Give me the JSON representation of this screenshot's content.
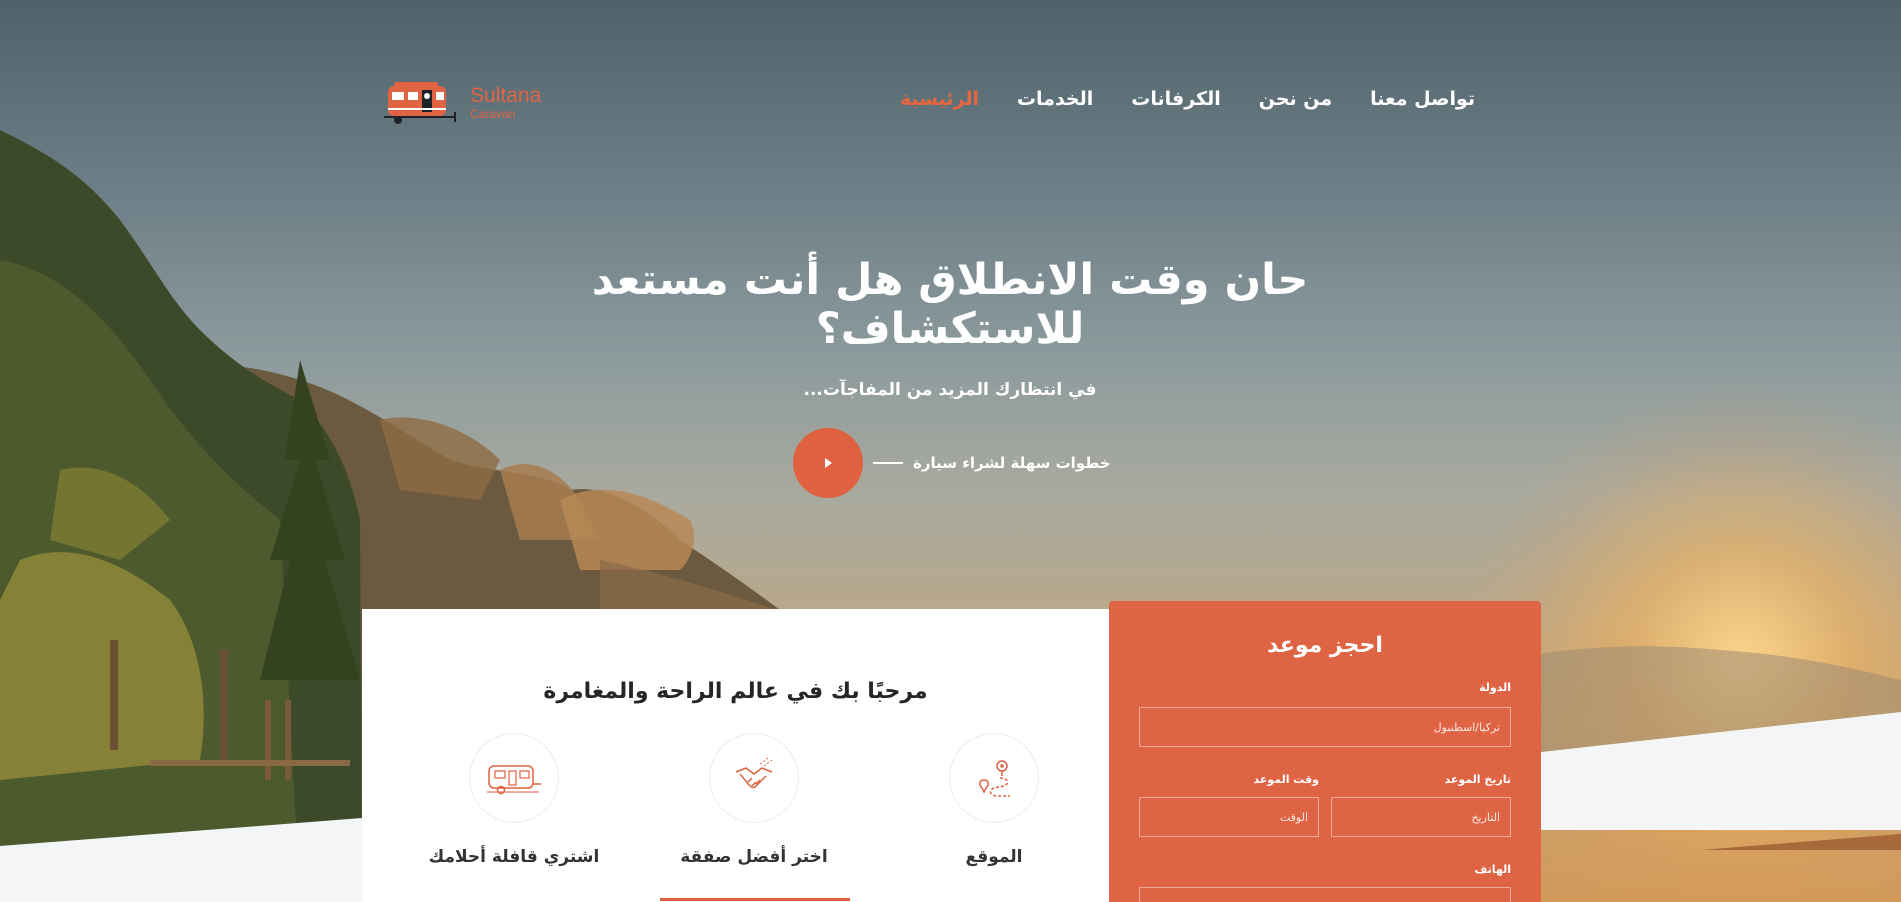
{
  "brand": {
    "name": "Sultana",
    "sub": "Caravan",
    "accent": "#df6140"
  },
  "nav": {
    "items": [
      {
        "label": "الرئيسية",
        "active": true
      },
      {
        "label": "الخدمات",
        "active": false
      },
      {
        "label": "الكرفانات",
        "active": false
      },
      {
        "label": "من نحن",
        "active": false
      },
      {
        "label": "تواصل معنا",
        "active": false
      }
    ]
  },
  "hero": {
    "title": "حان وقت الانطلاق هل أنت مستعد للاستكشاف؟",
    "subtitle": "في انتظارك المزيد من المفاجآت...",
    "video_label": "خطوات سهلة لشراء سيارة"
  },
  "welcome": {
    "title": "مرحبًا بك في عالم الراحة والمغامرة",
    "features": [
      {
        "label": "الموقع",
        "icon": "location-route-icon"
      },
      {
        "label": "اختر أفضل صفقة",
        "icon": "handshake-icon"
      },
      {
        "label": "اشتري قافلة أحلامك",
        "icon": "caravan-icon"
      }
    ]
  },
  "booking": {
    "title": "احجز موعد",
    "country_label": "الدولة",
    "country_placeholder": "تركيا/اسطنبول",
    "date_label": "تاريخ الموعد",
    "date_placeholder": "التاريخ",
    "time_label": "وقت الموعد",
    "time_placeholder": "الوقت",
    "phone_label": "الهاتف"
  }
}
